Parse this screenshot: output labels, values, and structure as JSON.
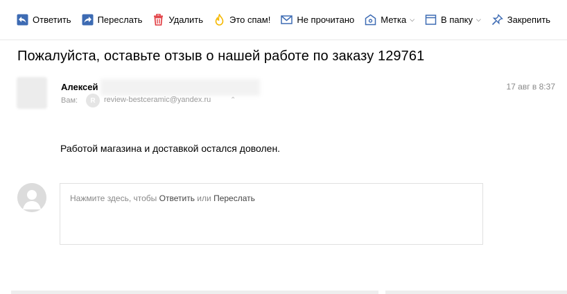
{
  "toolbar": {
    "reply": {
      "label": "Ответить",
      "icon": "reply-icon"
    },
    "forward": {
      "label": "Переслать",
      "icon": "forward-icon"
    },
    "delete": {
      "label": "Удалить",
      "icon": "trash-icon"
    },
    "spam": {
      "label": "Это спам!",
      "icon": "fire-icon"
    },
    "unread": {
      "label": "Не прочитано",
      "icon": "envelope-icon"
    },
    "label": {
      "label": "Метка",
      "icon": "tag-icon"
    },
    "folder": {
      "label": "В папку",
      "icon": "folder-icon"
    },
    "pin": {
      "label": "Закрепить",
      "icon": "pin-icon"
    }
  },
  "message": {
    "subject": "Пожалуйста, оставьте отзыв о нашей работе по заказу 129761",
    "sender_name": "Алексей",
    "to_label": "Вам:",
    "to_avatar_letter": "R",
    "to_email": "review-bestceramic@yandex.ru",
    "date": "17 авг в 8:37",
    "body": "Работой магазина и доставкой остался доволен."
  },
  "quick_reply": {
    "hint_prefix": "Нажмите здесь, чтобы",
    "reply_link": "Ответить",
    "or": "или",
    "forward_link": "Переслать"
  },
  "colors": {
    "accent_blue": "#3d6bb3",
    "delete_red": "#e0363b",
    "spam_yellow": "#f5b800"
  }
}
